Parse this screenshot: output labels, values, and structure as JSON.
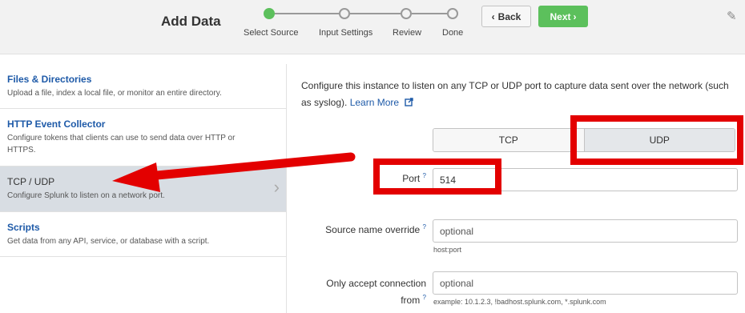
{
  "header": {
    "title": "Add Data",
    "steps": [
      {
        "label": "Select Source",
        "active": true
      },
      {
        "label": "Input Settings",
        "active": false
      },
      {
        "label": "Review",
        "active": false
      },
      {
        "label": "Done",
        "active": false
      }
    ],
    "back_label": "Back",
    "next_label": "Next",
    "back_chevron": "‹",
    "next_chevron": "›"
  },
  "sidebar": {
    "items": [
      {
        "title": "Files & Directories",
        "desc": "Upload a file, index a local file, or monitor an entire directory.",
        "selected": false
      },
      {
        "title": "HTTP Event Collector",
        "desc": "Configure tokens that clients can use to send data over HTTP or HTTPS.",
        "selected": false
      },
      {
        "title": "TCP / UDP",
        "desc": "Configure Splunk to listen on a network port.",
        "selected": true
      },
      {
        "title": "Scripts",
        "desc": "Get data from any API, service, or database with a script.",
        "selected": false
      }
    ]
  },
  "main": {
    "description": "Configure this instance to listen on any TCP or UDP port to capture data sent over the network (such as syslog).",
    "learn_more": "Learn More",
    "protocol": {
      "tcp_label": "TCP",
      "udp_label": "UDP",
      "selected": "UDP"
    },
    "port": {
      "label": "Port",
      "help": "?",
      "value": "514"
    },
    "source_override": {
      "label": "Source name override",
      "help": "?",
      "placeholder": "optional",
      "hint": "host:port"
    },
    "accept_from": {
      "label_line1": "Only accept connection",
      "label_line2": "from",
      "help": "?",
      "placeholder": "optional",
      "hint": "example: 10.1.2.3, !badhost.splunk.com, *.splunk.com"
    }
  },
  "colors": {
    "accent_green": "#5cc05c",
    "link_blue": "#1e5aa8",
    "annotation_red": "#e30000"
  },
  "icons": [
    "pencil-icon",
    "chevron-right-icon",
    "external-link-icon"
  ]
}
